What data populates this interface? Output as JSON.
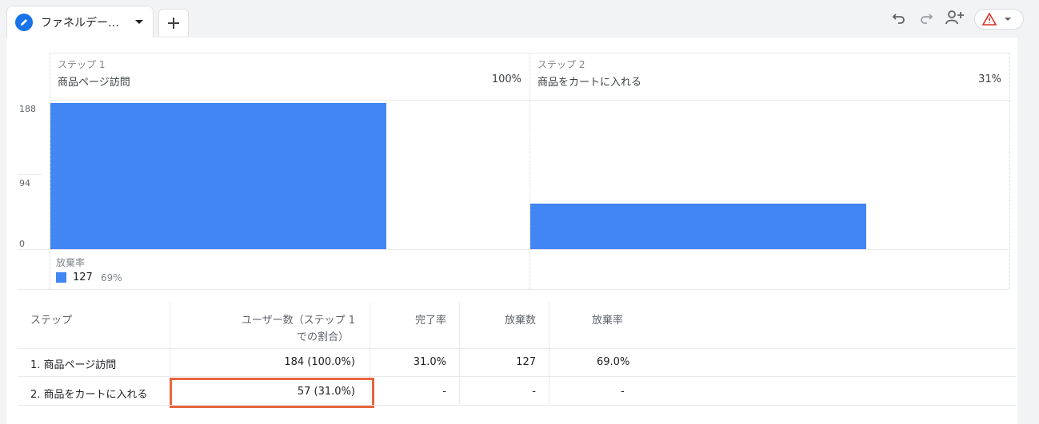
{
  "tabs": {
    "active_label": "ファネルデー…",
    "add_tab": "+"
  },
  "toolbar": {
    "icons": [
      "undo-icon",
      "redo-icon",
      "share-user-icon",
      "warning-icon"
    ]
  },
  "steps": [
    {
      "label": "ステップ 1",
      "name": "商品ページ訪問",
      "percent": "100%"
    },
    {
      "label": "ステップ 2",
      "name": "商品をカートに入れる",
      "percent": "31%"
    }
  ],
  "chart_data": {
    "type": "bar",
    "categories": [
      "商品ページ訪問",
      "商品をカートに入れる"
    ],
    "values": [
      184,
      57
    ],
    "yticks": [
      "188",
      "94",
      "0"
    ],
    "ylim": [
      0,
      188
    ],
    "color": "#4285f4"
  },
  "abandonment": {
    "label": "放棄率",
    "count": "127",
    "percent": "69%"
  },
  "table": {
    "headers": {
      "step": "ステップ",
      "users_line1": "ユーザー数（ステップ 1",
      "users_line2": "での割合）",
      "completion": "完了率",
      "abandon_count": "放棄数",
      "abandon_rate": "放棄率"
    },
    "rows": [
      {
        "step": "1. 商品ページ訪問",
        "users": "184 (100.0%)",
        "completion": "31.0%",
        "abandon_count": "127",
        "abandon_rate": "69.0%"
      },
      {
        "step": "2. 商品をカートに入れる",
        "users": "57 (31.0%)",
        "completion": "-",
        "abandon_count": "-",
        "abandon_rate": "-"
      }
    ]
  },
  "colors": {
    "bar": "#4285f4",
    "highlight": "#e8663d",
    "accent": "#1a73e8"
  }
}
